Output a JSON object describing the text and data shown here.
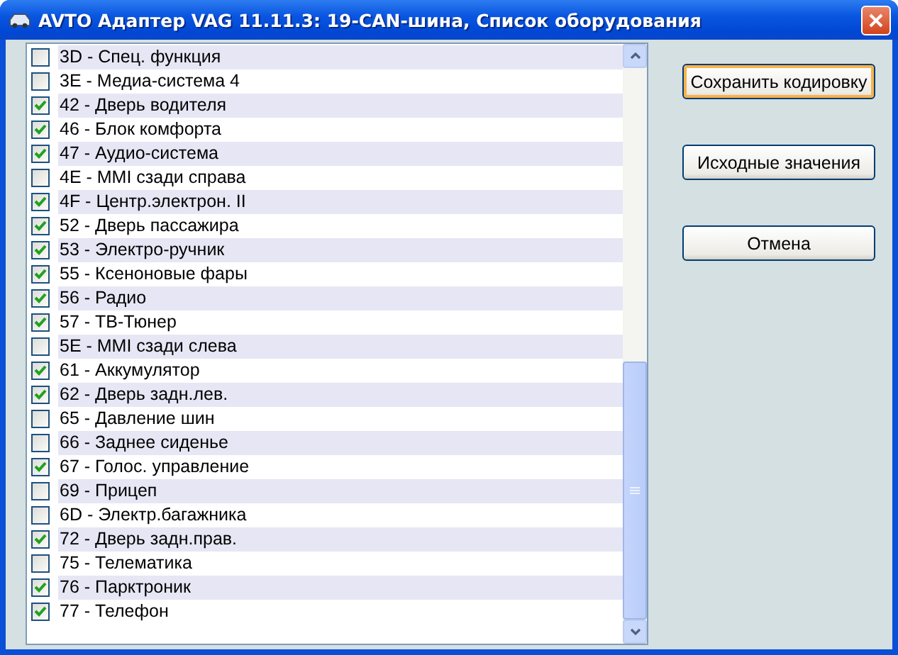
{
  "window": {
    "title": "AVTO Адаптер VAG 11.11.3: 19-CAN-шина,  Список оборудования"
  },
  "items": [
    {
      "label": "3D - Спец. функция",
      "checked": false
    },
    {
      "label": "3E - Медиа-система 4",
      "checked": false
    },
    {
      "label": "42 - Дверь водителя",
      "checked": true
    },
    {
      "label": "46 - Блок комфорта",
      "checked": true
    },
    {
      "label": "47 - Аудио-система",
      "checked": true
    },
    {
      "label": "4E - MMI сзади справа",
      "checked": false
    },
    {
      "label": "4F - Центр.электрон. II",
      "checked": true
    },
    {
      "label": "52 - Дверь пассажира",
      "checked": true
    },
    {
      "label": "53 - Электро-ручник",
      "checked": true
    },
    {
      "label": "55 - Ксеноновые фары",
      "checked": true
    },
    {
      "label": "56 - Радио",
      "checked": true
    },
    {
      "label": "57 - ТВ-Тюнер",
      "checked": true
    },
    {
      "label": "5E - MMI сзади слева",
      "checked": false
    },
    {
      "label": "61 - Аккумулятор",
      "checked": true
    },
    {
      "label": "62 - Дверь задн.лев.",
      "checked": true
    },
    {
      "label": "65 - Давление шин",
      "checked": false
    },
    {
      "label": "66 - Заднее сиденье",
      "checked": false
    },
    {
      "label": "67 - Голос. управление",
      "checked": true
    },
    {
      "label": "69 - Прицеп",
      "checked": false
    },
    {
      "label": "6D - Электр.багажника",
      "checked": false
    },
    {
      "label": "72 - Дверь задн.прав.",
      "checked": true
    },
    {
      "label": "75 - Телематика",
      "checked": false
    },
    {
      "label": "76 - Парктроник",
      "checked": true
    },
    {
      "label": "77 - Телефон",
      "checked": true
    }
  ],
  "buttons": [
    {
      "label": "Сохранить кодировку",
      "default": true
    },
    {
      "label": "Исходные значения",
      "default": false
    },
    {
      "label": "Отмена",
      "default": false
    }
  ]
}
